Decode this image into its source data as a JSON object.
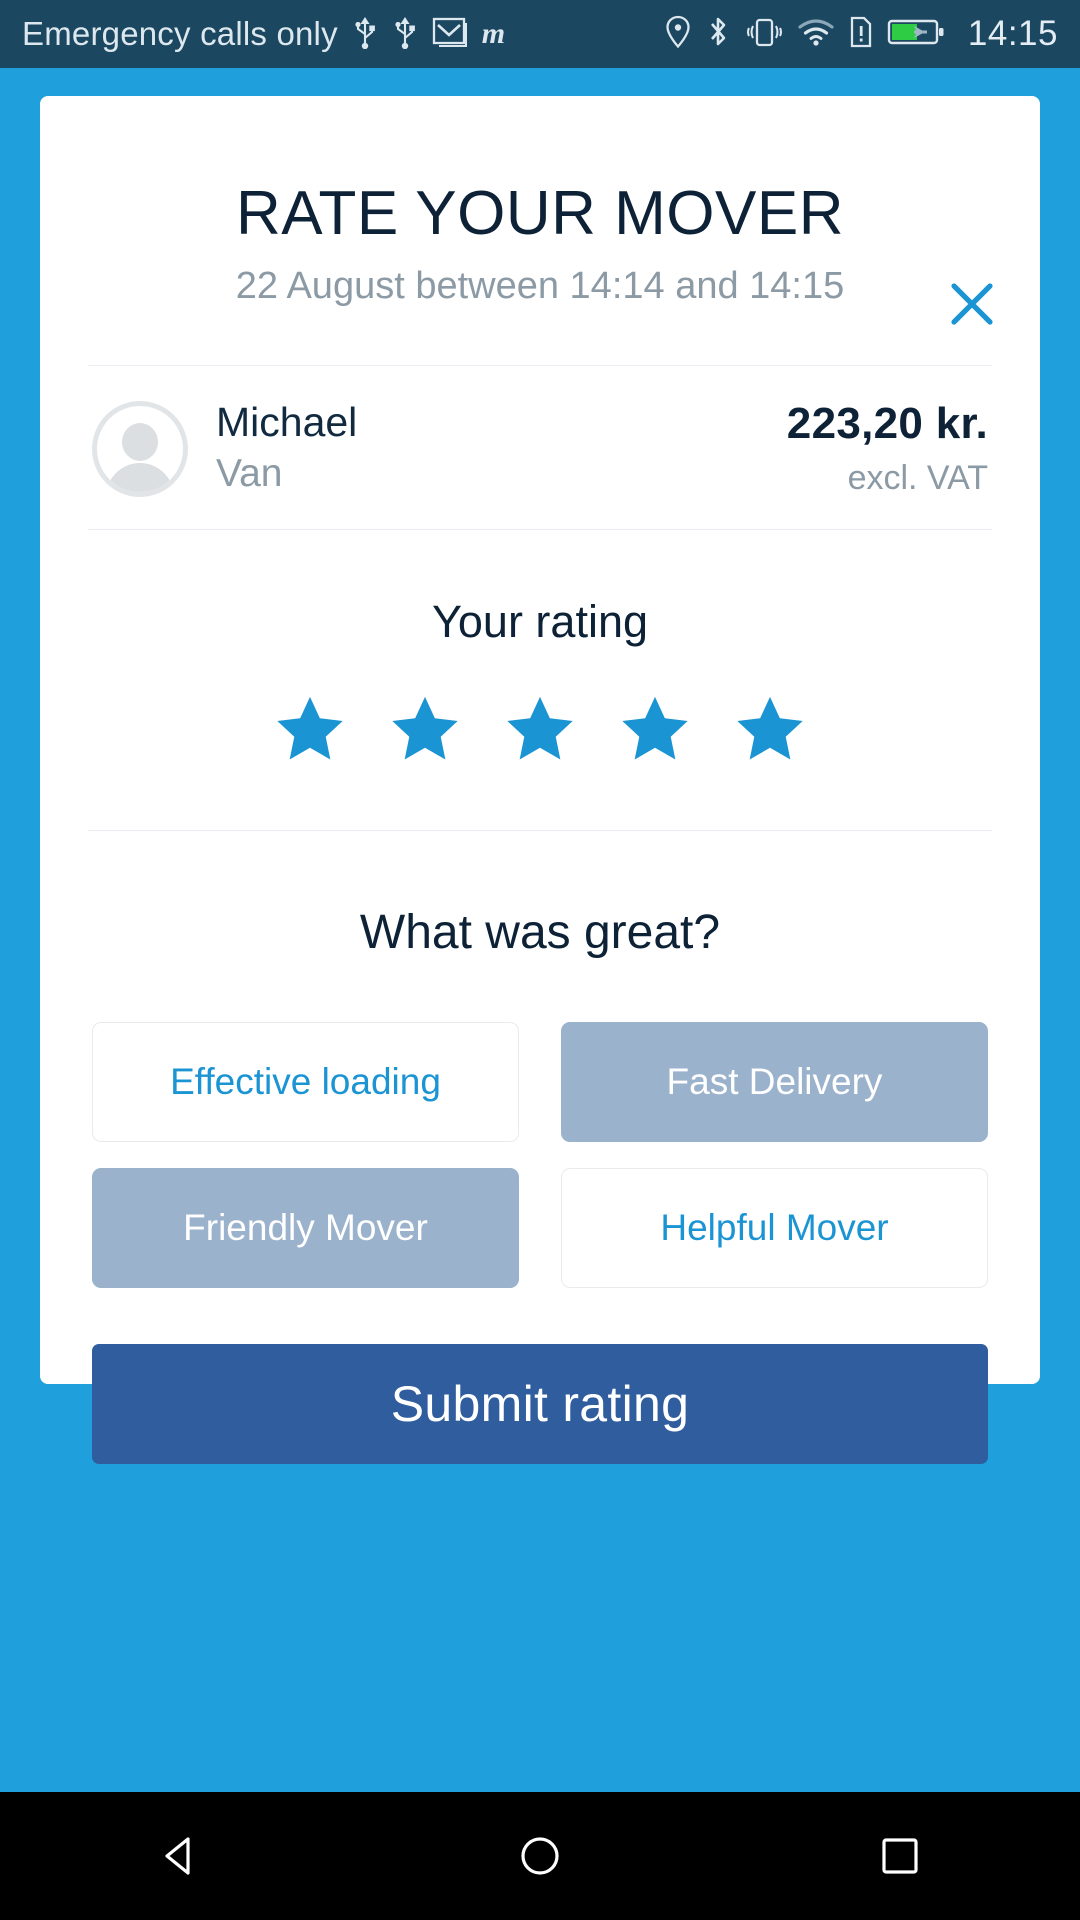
{
  "status_bar": {
    "carrier_text": "Emergency calls only",
    "time": "14:15",
    "left_icons": [
      "usb-icon",
      "usb-icon",
      "gmail-icon",
      "m-app-icon"
    ],
    "right_icons": [
      "location-pin-icon",
      "bluetooth-icon",
      "vibrate-icon",
      "wifi-icon",
      "sim-alert-icon",
      "battery-charging-icon"
    ],
    "m_glyph": "m",
    "background_color": "#1b4761",
    "text_color": "#dde7ee",
    "battery_fill_color": "#2ecc45"
  },
  "dialog": {
    "title": "RATE YOUR MOVER",
    "subtitle": "22 August between 14:14 and 14:15",
    "close_icon": "close-icon",
    "close_color": "#1b94d4"
  },
  "mover": {
    "avatar_icon": "person-avatar-icon",
    "name": "Michael",
    "vehicle": "Van",
    "price": "223,20 kr.",
    "price_note": "excl. VAT"
  },
  "rating": {
    "label": "Your rating",
    "value": 5,
    "max": 5,
    "star_color": "#1b94d4",
    "stars": [
      "star-filled",
      "star-filled",
      "star-filled",
      "star-filled",
      "star-filled"
    ]
  },
  "feedback": {
    "title": "What was great?",
    "chips": [
      {
        "label": "Effective loading",
        "selected": false
      },
      {
        "label": "Fast Delivery",
        "selected": true
      },
      {
        "label": "Friendly Mover",
        "selected": true
      },
      {
        "label": "Helpful Mover",
        "selected": false
      }
    ],
    "selected_bg": "#9bb2cd",
    "unselected_text": "#1b94d4"
  },
  "submit": {
    "label": "Submit rating",
    "background_color": "#2f5d9e"
  },
  "nav_bar": {
    "back_icon": "back-triangle-icon",
    "home_icon": "home-circle-icon",
    "recents_icon": "recents-square-icon",
    "background_color": "#000000"
  },
  "page": {
    "background_color": "#1fa0dd"
  }
}
